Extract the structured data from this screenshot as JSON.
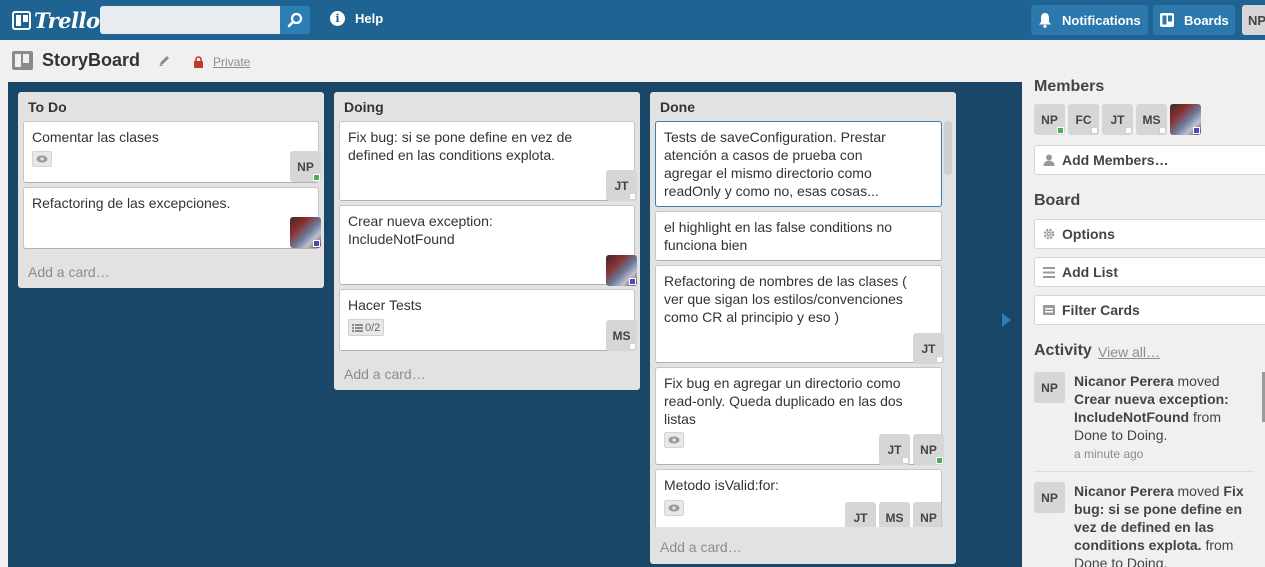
{
  "header": {
    "logo_text": "Trello",
    "search_placeholder": "",
    "help_label": "Help",
    "notifications_label": "Notifications",
    "boards_label": "Boards",
    "user_initials": "NP"
  },
  "board": {
    "title": "StoryBoard",
    "privacy": "Private"
  },
  "lists": [
    {
      "title": "To Do",
      "add_card": "Add a card…",
      "cards": [
        {
          "text": "Comentar las clases",
          "members": [
            "NP"
          ]
        },
        {
          "text": "Refactoring de las excepciones.",
          "members": [
            "photo"
          ]
        }
      ]
    },
    {
      "title": "Doing",
      "add_card": "Add a card…",
      "cards": [
        {
          "text_line1": "Fix bug: si se pone define en vez de",
          "text_line2": "defined en las conditions explota.",
          "members": [
            "JT"
          ]
        },
        {
          "text_line1": "Crear nueva exception:",
          "text_line2": "IncludeNotFound",
          "members": [
            "photo"
          ]
        },
        {
          "text": "Hacer Tests",
          "checklist": "0/2",
          "members": [
            "MS"
          ]
        }
      ]
    },
    {
      "title": "Done",
      "add_card": "Add a card…",
      "cards": [
        {
          "lines": [
            "Tests de saveConfiguration. Prestar",
            "atención a casos de prueba con",
            "agregar el mismo directorio como",
            "readOnly y como no, esas cosas..."
          ]
        },
        {
          "lines": [
            "el highlight en las false conditions no",
            "funciona bien"
          ]
        },
        {
          "lines": [
            "Refactoring de nombres de las clases (",
            "ver que sigan los estilos/convenciones",
            "como CR al principio y eso )"
          ],
          "members": [
            "JT"
          ]
        },
        {
          "lines": [
            "Fix bug en agregar un directorio como",
            "read-only. Queda duplicado en las dos",
            "listas"
          ],
          "members": [
            "JT",
            "NP"
          ]
        },
        {
          "lines": [
            "Metodo isValid:for:"
          ],
          "members": [
            "JT",
            "MS",
            "NP"
          ]
        }
      ]
    }
  ],
  "sidebar": {
    "members_heading": "Members",
    "members": [
      "NP",
      "FC",
      "JT",
      "MS"
    ],
    "add_members": "Add Members…",
    "board_heading": "Board",
    "options": "Options",
    "add_list": "Add List",
    "filter_cards": "Filter Cards",
    "activity_heading": "Activity",
    "view_all": "View all…",
    "activity": [
      {
        "initials": "NP",
        "user": "Nicanor Perera",
        "verb": "moved",
        "card": "Crear nueva exception: IncludeNotFound",
        "from_text": "from",
        "detail": "Done to Doing.",
        "time": "a minute ago"
      },
      {
        "initials": "NP",
        "user": "Nicanor Perera",
        "verb": "moved",
        "card": "Fix bug: si se pone define en vez de defined en las conditions explota.",
        "from_text": "from",
        "detail": "Done to Doing."
      }
    ]
  },
  "colors": {
    "header": "#1f6392",
    "board_bg": "#1a4768",
    "list_bg": "#e2e2e2"
  }
}
